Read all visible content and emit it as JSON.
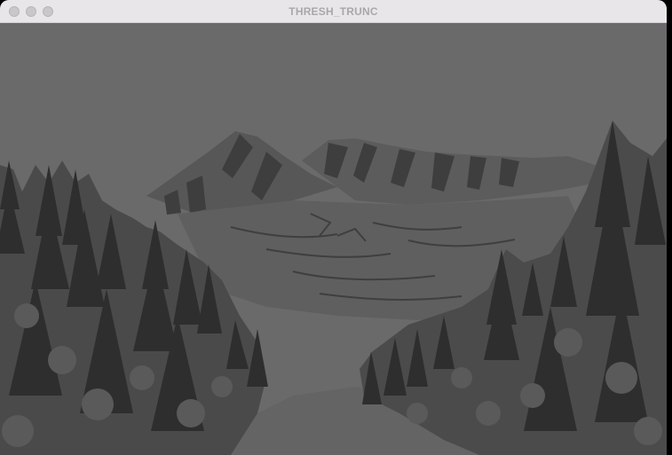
{
  "window": {
    "title": "THRESH_TRUNC",
    "traffic_lights": [
      "close",
      "minimize",
      "zoom"
    ]
  },
  "image": {
    "content": "thresholded-mountain-forest-photo",
    "background_gray": "#6a6a6a"
  },
  "colors": {
    "titlebar_bg": "#e8e6e8",
    "title_text": "#a9a7a9",
    "traffic_light": "#c9c7c9",
    "truncated_gray": "#6a6a6a",
    "dark_detail": "#3a3a3a",
    "darker_detail": "#2a2a2a"
  }
}
